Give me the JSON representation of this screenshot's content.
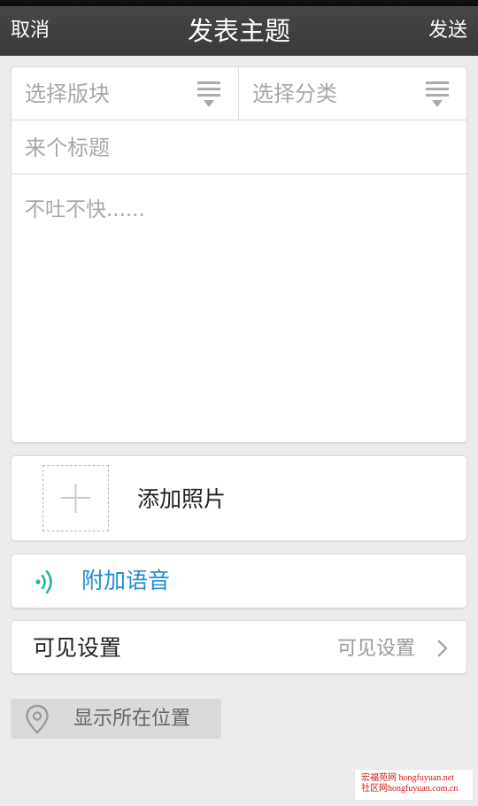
{
  "header": {
    "cancel_label": "取消",
    "title": "发表主题",
    "send_label": "发送"
  },
  "form": {
    "board_select": {
      "placeholder": "选择版块",
      "icon": "dropdown-menu-icon"
    },
    "category_select": {
      "placeholder": "选择分类",
      "icon": "dropdown-menu-icon"
    },
    "title_placeholder": "来个标题",
    "content_placeholder": "不吐不快......"
  },
  "photo": {
    "icon": "plus-icon",
    "label": "添加照片"
  },
  "voice": {
    "icon": "sound-wave-icon",
    "label": "附加语音",
    "color": "#1d8fcf",
    "icon_color": "#2ab59a"
  },
  "visibility": {
    "label": "可见设置",
    "value": "可见设置",
    "icon": "chevron-right-icon"
  },
  "location": {
    "icon": "location-pin-icon",
    "label": "显示所在位置"
  },
  "watermark": {
    "line1": "宏福苑网 hongfuyuan.net",
    "line2": "社区网hongfuyuan.com.cn",
    "color": "#d01818"
  },
  "colors": {
    "topbar": "#414141",
    "background": "#ececec",
    "placeholder": "#a8a8a8"
  }
}
